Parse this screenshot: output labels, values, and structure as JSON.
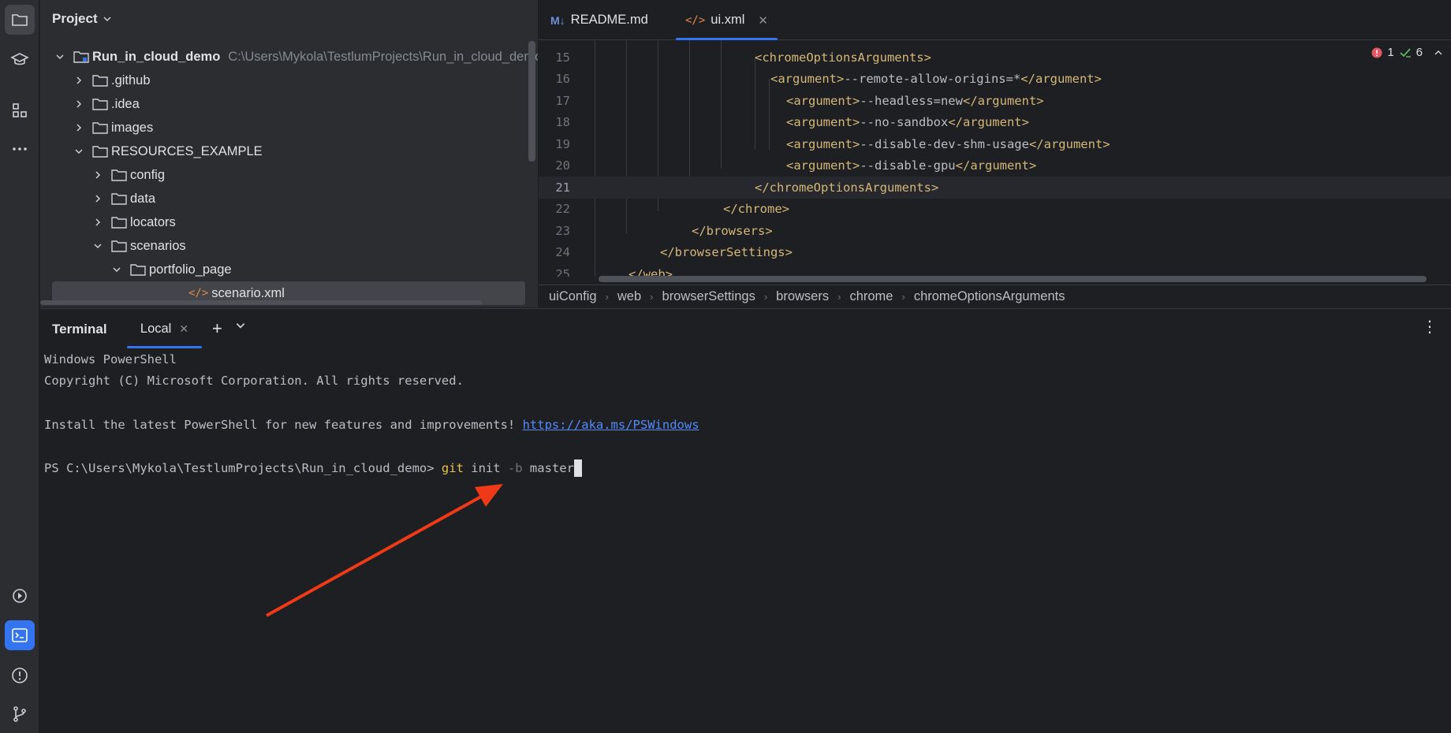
{
  "project": {
    "title": "Project",
    "root": {
      "name": "Run_in_cloud_demo",
      "path": "C:\\Users\\Mykola\\TestlumProjects\\Run_in_cloud_demo"
    },
    "items": [
      {
        "label": ".github"
      },
      {
        "label": ".idea"
      },
      {
        "label": "images"
      },
      {
        "label": "RESOURCES_EXAMPLE"
      },
      {
        "label": "config"
      },
      {
        "label": "data"
      },
      {
        "label": "locators"
      },
      {
        "label": "scenarios"
      },
      {
        "label": "portfolio_page"
      },
      {
        "label": "scenario.xml"
      }
    ]
  },
  "editor": {
    "tabs": [
      {
        "icon": "M↓",
        "label": "README.md"
      },
      {
        "icon": "</>",
        "label": "ui.xml"
      }
    ],
    "inspections": {
      "errors": "1",
      "warnings": "6"
    },
    "lines": [
      {
        "num": "15",
        "open": "<chromeOptionsArguments>",
        "value": "",
        "close": ""
      },
      {
        "num": "16",
        "open": "<argument>",
        "value": "--remote-allow-origins=*",
        "close": "</argument>"
      },
      {
        "num": "17",
        "open": "<argument>",
        "value": "--headless=new",
        "close": "</argument>"
      },
      {
        "num": "18",
        "open": "<argument>",
        "value": "--no-sandbox",
        "close": "</argument>"
      },
      {
        "num": "19",
        "open": "<argument>",
        "value": "--disable-dev-shm-usage",
        "close": "</argument>"
      },
      {
        "num": "20",
        "open": "<argument>",
        "value": "--disable-gpu",
        "close": "</argument>"
      },
      {
        "num": "21",
        "open": "</chromeOptionsArguments>",
        "value": "",
        "close": ""
      },
      {
        "num": "22",
        "open": "</chrome>",
        "value": "",
        "close": ""
      },
      {
        "num": "23",
        "open": "</browsers>",
        "value": "",
        "close": ""
      },
      {
        "num": "24",
        "open": "</browserSettings>",
        "value": "",
        "close": ""
      },
      {
        "num": "25",
        "open": "</web>",
        "value": "",
        "close": ""
      }
    ],
    "breadcrumbs": [
      "uiConfig",
      "web",
      "browserSettings",
      "browsers",
      "chrome",
      "chromeOptionsArguments"
    ]
  },
  "terminal": {
    "title": "Terminal",
    "tab": "Local",
    "lines": {
      "l1": "Windows PowerShell",
      "l2": "Copyright (C) Microsoft Corporation. All rights reserved.",
      "l3_text": "Install the latest PowerShell for new features and improvements! ",
      "l3_link": "https://aka.ms/PSWindows",
      "prompt": "PS C:\\Users\\Mykola\\TestlumProjects\\Run_in_cloud_demo> ",
      "cmd_git": "git",
      "cmd_init": " init ",
      "cmd_flag": "-b",
      "cmd_branch": " master"
    }
  },
  "colors": {
    "accent": "#3574f0",
    "annotation_arrow": "#f03a17",
    "tag": "#d5b778"
  }
}
